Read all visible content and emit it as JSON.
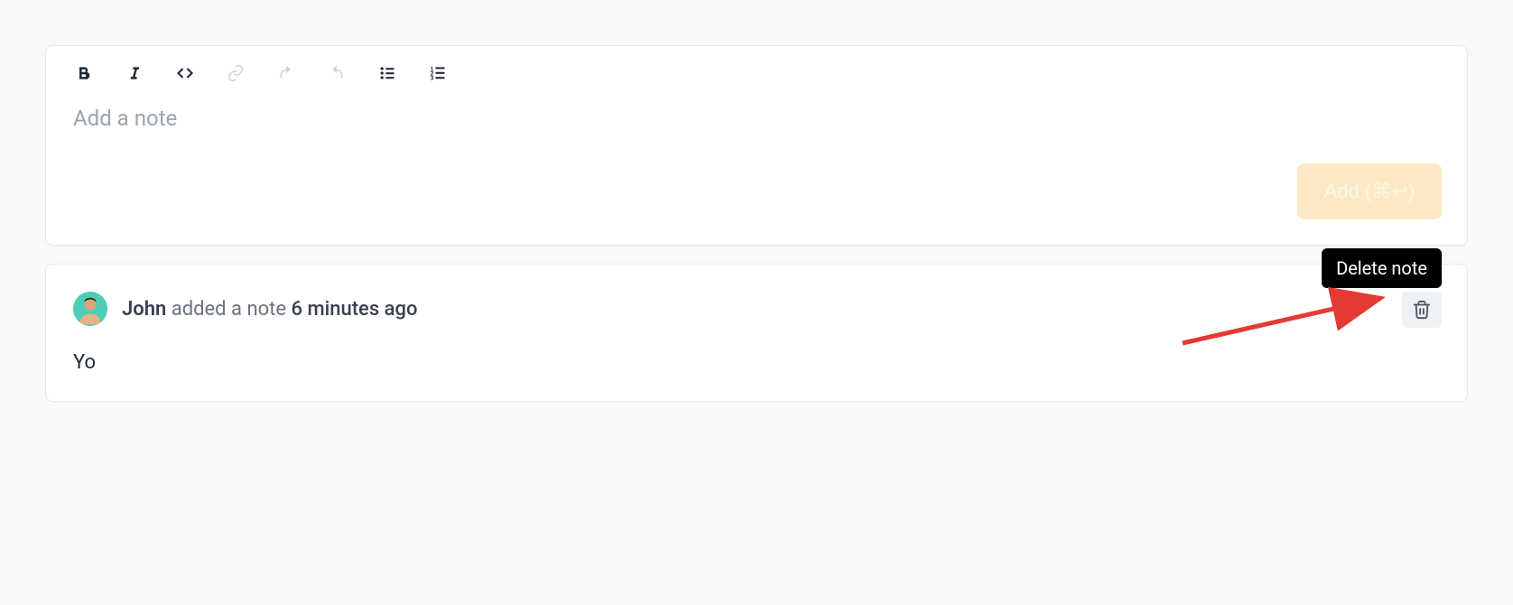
{
  "editor": {
    "placeholder": "Add a note",
    "addButton": {
      "label": "Add",
      "shortcut": "(⌘↩)"
    }
  },
  "note": {
    "author": "John",
    "action": " added a note ",
    "time": "6 minutes ago",
    "content": "Yo"
  },
  "tooltip": {
    "deleteNote": "Delete note"
  }
}
